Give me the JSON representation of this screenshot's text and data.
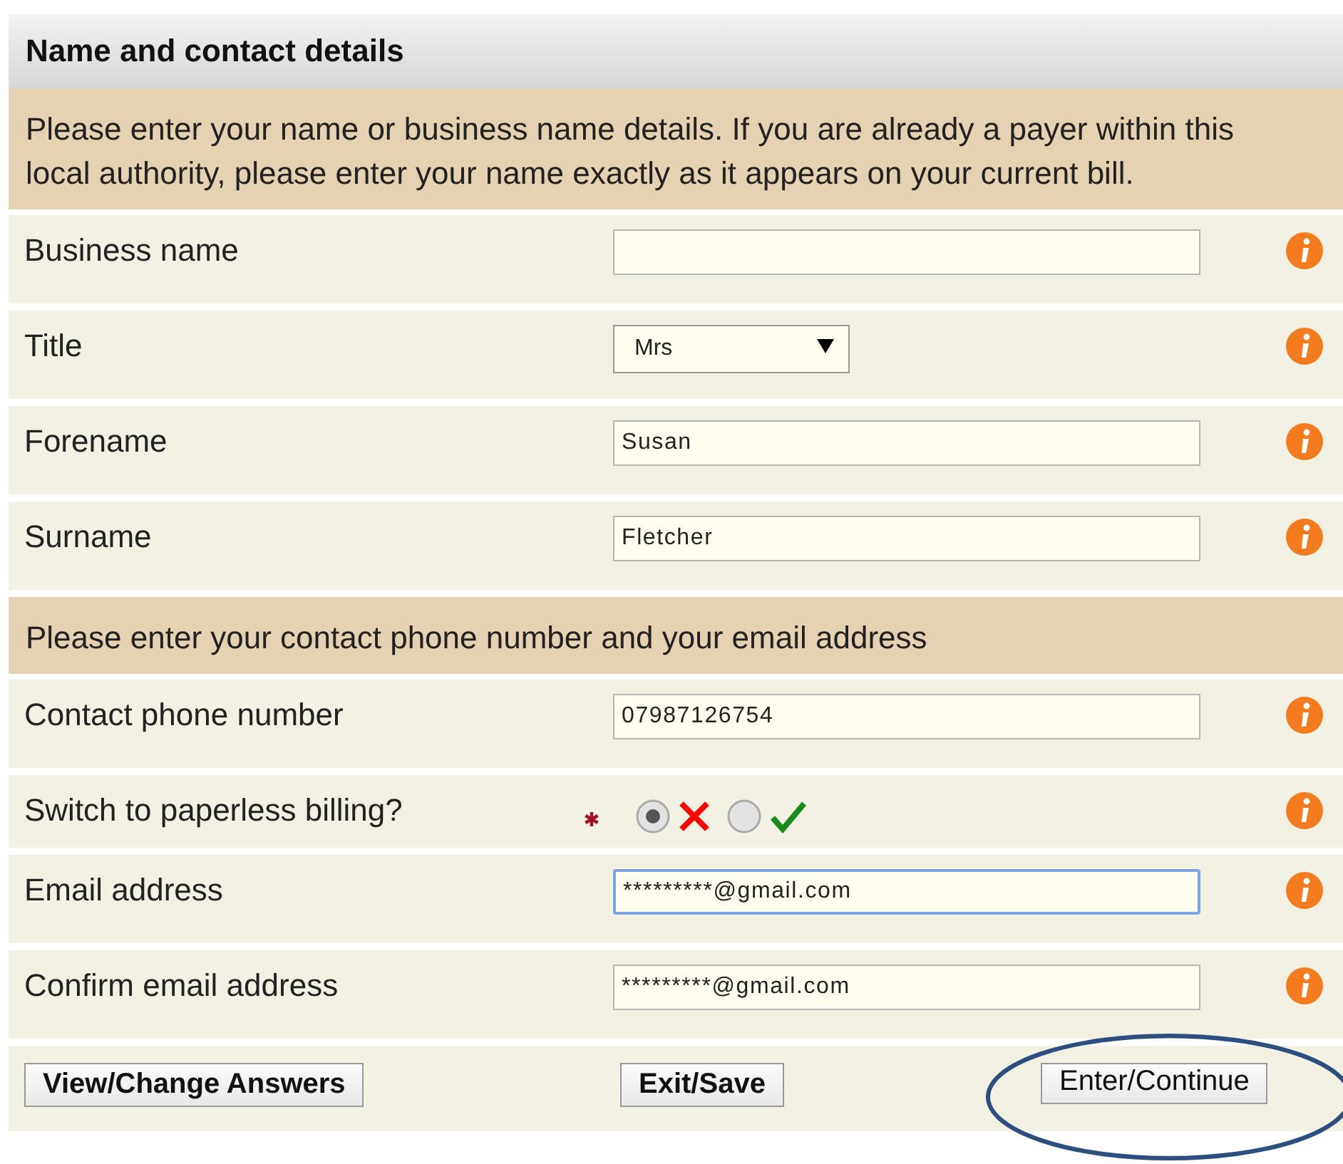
{
  "section": {
    "title": "Name and contact details"
  },
  "groups": [
    {
      "intro": "Please enter your name or business name details. If you are already a payer within this local authority, please enter your name exactly as it appears on your current bill.",
      "fields": [
        {
          "kind": "text",
          "label": "Business name",
          "focused": false
        },
        {
          "kind": "select",
          "label": "Title",
          "value": "Mrs"
        },
        {
          "kind": "text",
          "label": "Forename",
          "value": "Susan",
          "focused": false
        },
        {
          "kind": "text",
          "label": "Surname",
          "value": "Fletcher",
          "focused": false
        }
      ]
    },
    {
      "intro": "Please enter your contact phone number and your email address",
      "fields": [
        {
          "kind": "text",
          "label": "Contact phone number",
          "value": "07987126754",
          "focused": false
        },
        {
          "kind": "radio",
          "label": "Switch to paperless billing?",
          "required": true,
          "options": [
            {
              "kind": "cross",
              "selected": true
            },
            {
              "kind": "tick",
              "selected": false
            }
          ]
        },
        {
          "kind": "text",
          "label": "Email address",
          "value": "*********@gmail.com",
          "focused": true
        },
        {
          "kind": "text",
          "label": "Confirm email address",
          "value": "*********@gmail.com",
          "focused": false
        }
      ]
    }
  ],
  "buttons": [
    {
      "label": "View/Change Answers",
      "circled": false
    },
    {
      "label": "Exit/Save",
      "circled": false
    },
    {
      "label": "Enter/Continue",
      "circled": true
    }
  ]
}
